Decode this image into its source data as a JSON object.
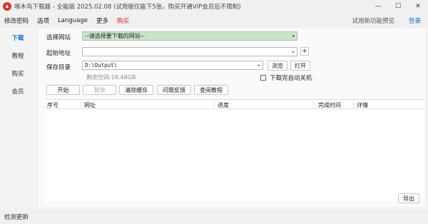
{
  "window": {
    "title": "啄木鸟下载器 - 全能版 2025.02.08 (试用版仅能下5张，购买开通VIP会员后不限制)",
    "minimize": "—",
    "maximize": "☐",
    "close": "✕"
  },
  "menubar": {
    "items": [
      "修改密码",
      "选项",
      "Language",
      "更多",
      "购买"
    ],
    "trial_link": "试用新功能预览",
    "login_link": "登录"
  },
  "sidebar": {
    "items": [
      "下载",
      "教程",
      "购买",
      "会员"
    ]
  },
  "form": {
    "site_label": "选择网站",
    "site_value": "--请选择要下载的网站--",
    "start_label": "起始地址",
    "start_value": "",
    "add_button": "+",
    "dir_label": "保存目录",
    "dir_value": "D:\\Output\\",
    "browse_button": "浏览",
    "open_button": "打开",
    "free_space": "剩余空间:19.48GB",
    "shutdown_label": "下载完自动关机",
    "shutdown_checked": false
  },
  "actions": {
    "start": "开始",
    "pause": "暂停",
    "clear_cache": "清除缓存",
    "feedback": "问题反馈",
    "tutorial": "查阅教程"
  },
  "table": {
    "headers": [
      "序号",
      "网址",
      "进度",
      "完成时间",
      "详情"
    ]
  },
  "export_button": "导出",
  "status": {
    "text": "检测更新"
  },
  "colors": {
    "site_select_bg": "#c8e6c8",
    "accent": "#1a6fd1",
    "buy": "#dd2222",
    "app_icon": "#d5372b"
  }
}
